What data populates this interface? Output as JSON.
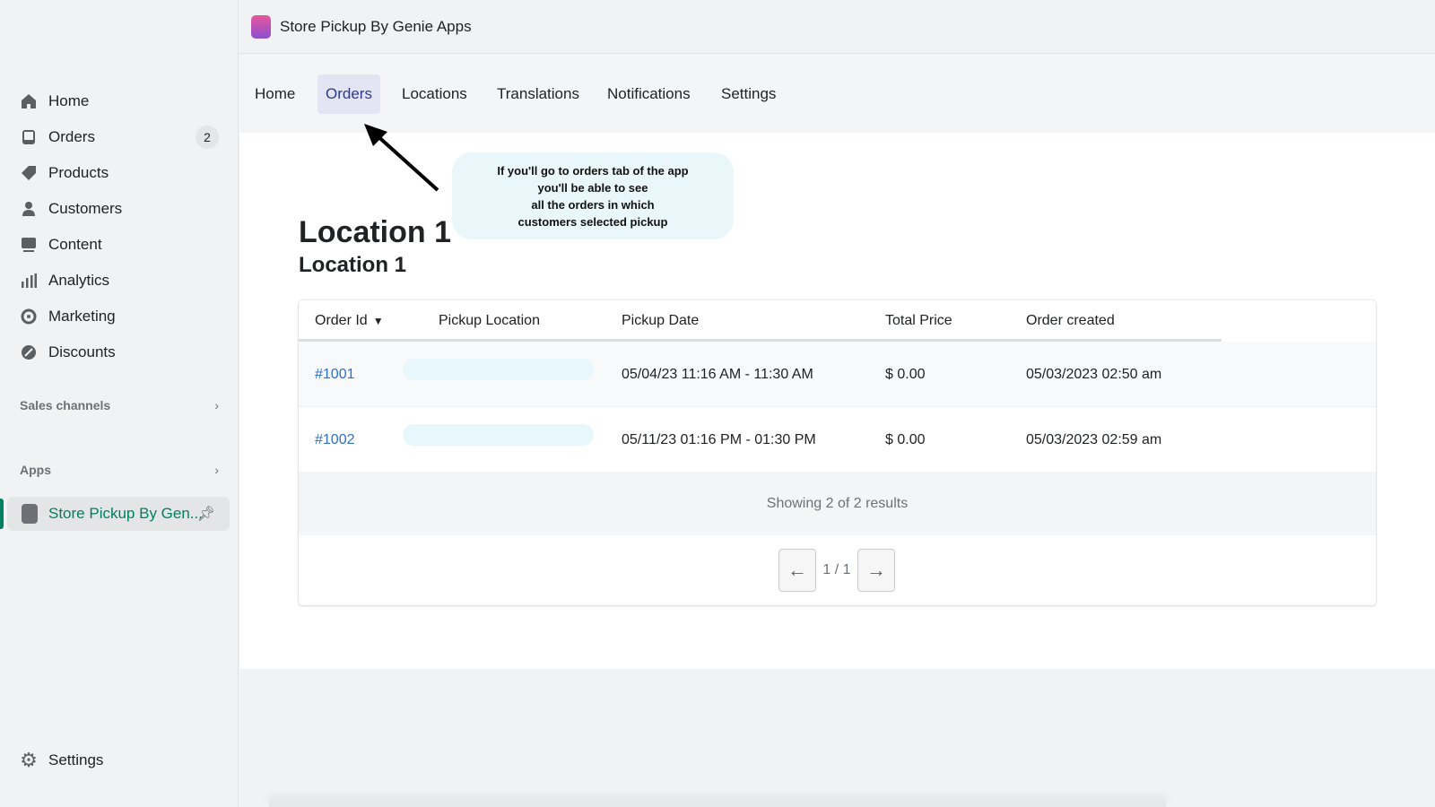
{
  "sidebar": {
    "items": [
      {
        "label": "Home",
        "icon": "home-icon"
      },
      {
        "label": "Orders",
        "icon": "orders-icon",
        "badge": "2"
      },
      {
        "label": "Products",
        "icon": "tag-icon"
      },
      {
        "label": "Customers",
        "icon": "person-icon"
      },
      {
        "label": "Content",
        "icon": "image-icon"
      },
      {
        "label": "Analytics",
        "icon": "bar-chart-icon"
      },
      {
        "label": "Marketing",
        "icon": "target-icon"
      },
      {
        "label": "Discounts",
        "icon": "discount-icon"
      }
    ],
    "sales_channels": "Sales channels",
    "apps": "Apps",
    "app_item": "Store Pickup By Gen...",
    "settings": "Settings"
  },
  "topbar": {
    "title": "Store Pickup By Genie Apps"
  },
  "tabs": [
    {
      "label": "Home"
    },
    {
      "label": "Orders",
      "active": true
    },
    {
      "label": "Locations"
    },
    {
      "label": "Translations"
    },
    {
      "label": "Notifications"
    },
    {
      "label": "Settings"
    }
  ],
  "callout": "If you'll go to orders tab of the app\nyou'll be able to see\nall the orders in which\ncustomers selected pickup",
  "main": {
    "title": "Location 1",
    "subtitle": "Location 1",
    "columns": [
      "Order Id",
      "Pickup Location",
      "Pickup Date",
      "Total Price",
      "Order created"
    ],
    "rows": [
      {
        "id": "#1001",
        "pickup_date": "05/04/23 11:16 AM - 11:30 AM",
        "total": "$ 0.00",
        "created": "05/03/2023 02:50 am"
      },
      {
        "id": "#1002",
        "pickup_date": "05/11/23 01:16 PM - 01:30 PM",
        "total": "$ 0.00",
        "created": "05/03/2023 02:59 am"
      }
    ],
    "footer": "Showing 2 of 2 results",
    "page": "1 / 1"
  },
  "colors": {
    "accent": "#008060",
    "link": "#2c6ecb",
    "active_tab_bg": "#e3e5f5"
  }
}
